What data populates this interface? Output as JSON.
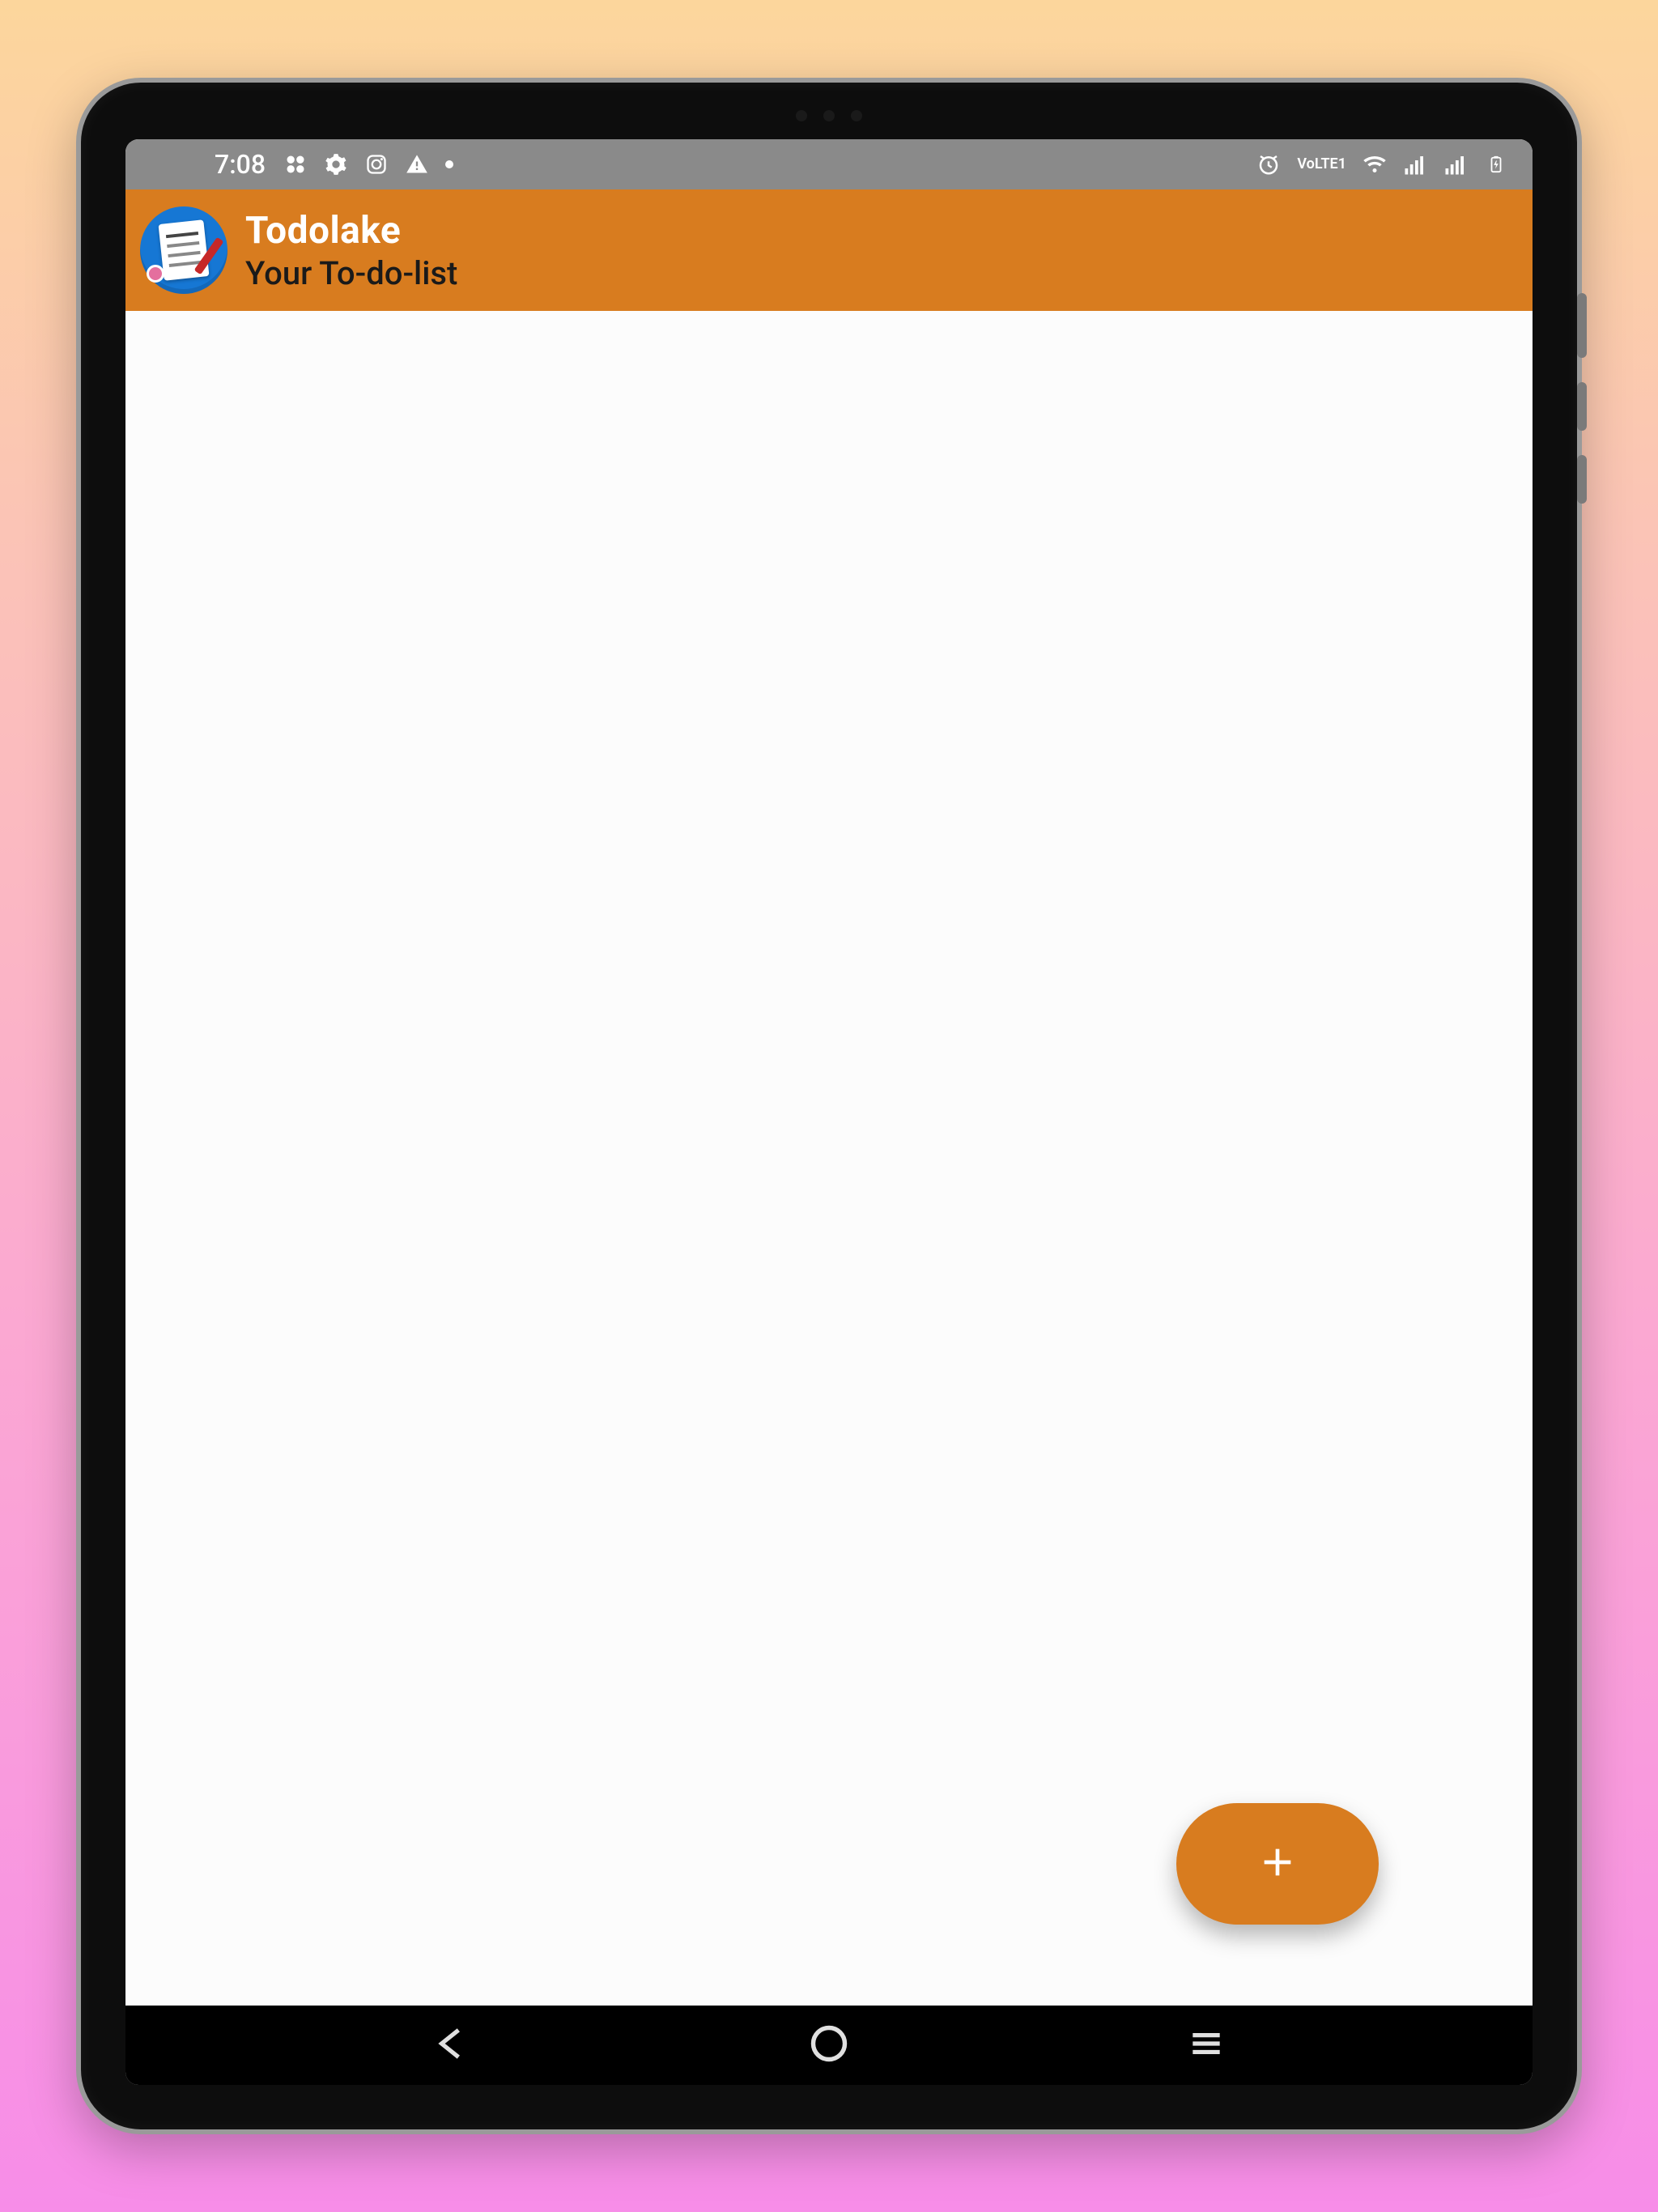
{
  "status_bar": {
    "time": "7:08",
    "left_icons": [
      "apps-icon",
      "settings-gear-icon",
      "instagram-icon",
      "warning-icon",
      "dot-icon"
    ],
    "right_icons": [
      "alarm-icon",
      "volte-icon",
      "wifi-icon",
      "signal-icon-1",
      "signal-icon-2",
      "battery-icon"
    ],
    "volte_label": "VoLTE1"
  },
  "app_header": {
    "title": "Todolake",
    "subtitle": "Your To-do-list"
  },
  "fab": {
    "aria_label": "Add"
  },
  "colors": {
    "accent": "#d87c1f",
    "logo_bg": "#1677d4",
    "status_bg": "#8a8a8a"
  }
}
